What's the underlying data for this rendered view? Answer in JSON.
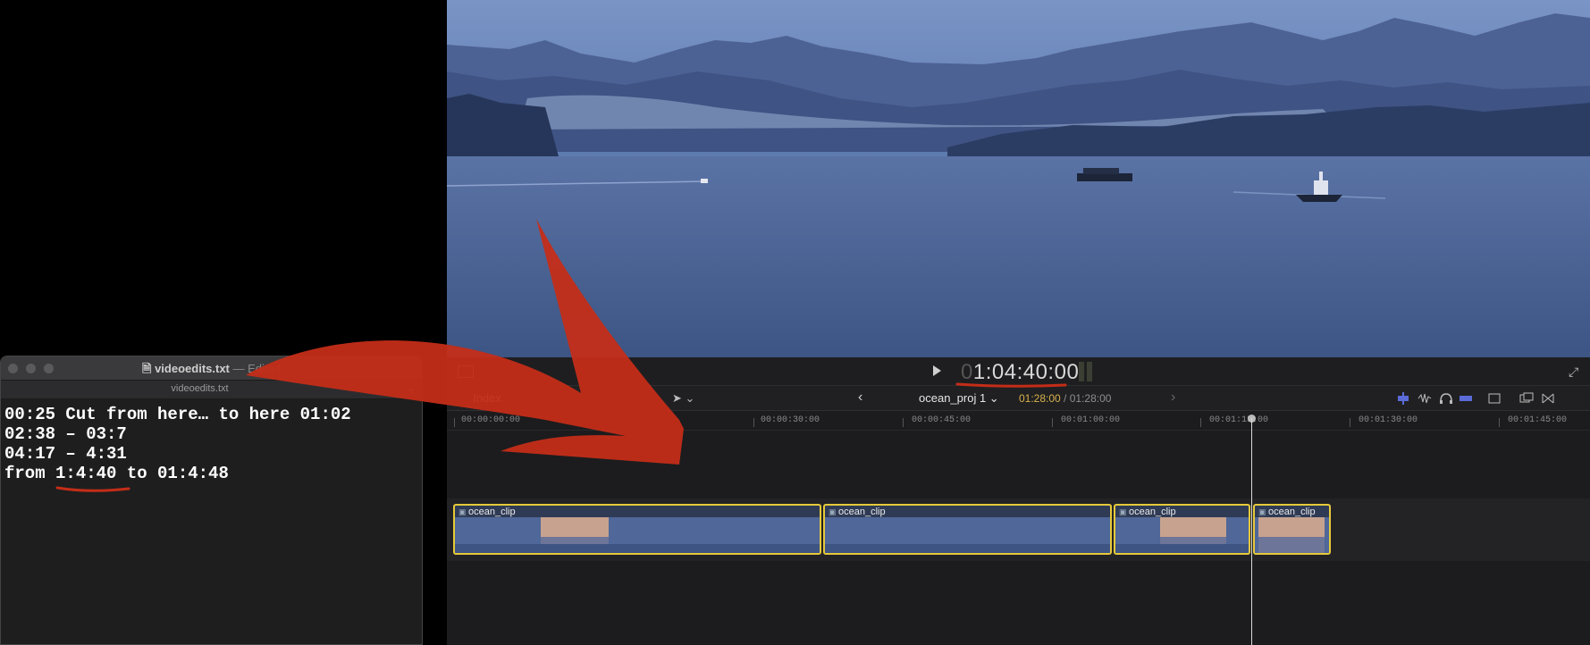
{
  "viewer": {
    "timecode_dim": "0",
    "timecode": "1:04:40:00"
  },
  "timeline": {
    "index_label": "Index",
    "project_name": "ocean_proj 1 ⌄",
    "current_duration": "01:28:00",
    "duration_separator": " / ",
    "total_duration": "01:28:00",
    "ruler_ticks": [
      "00:00:00:00",
      "00:00:30:00",
      "00:00:45:00",
      "00:01:00:00",
      "00:01:15:00",
      "00:01:30:00",
      "00:01:45:00"
    ],
    "clips": [
      {
        "label": "ocean_clip"
      },
      {
        "label": "ocean_clip"
      },
      {
        "label": "ocean_clip"
      },
      {
        "label": "ocean_clip"
      }
    ]
  },
  "textedit": {
    "title": "videoedits.txt",
    "title_suffix": "— Edited",
    "tab_title": "videoedits.txt",
    "lines": [
      "00:25 Cut from here… to here 01:02",
      "02:38 – 03:7",
      "04:17 – 4:31",
      "from 1:4:40 to 01:4:48"
    ]
  },
  "colors": {
    "clip_border": "#e7c93a",
    "annotation_red": "#c42d18",
    "duration_current": "#d7b14a"
  },
  "icons": [
    "play-icon",
    "expand-icon",
    "transform-icon",
    "select-tool-icon",
    "back-arrow-icon",
    "forward-arrow-icon",
    "document-icon",
    "new-tab-icon"
  ]
}
